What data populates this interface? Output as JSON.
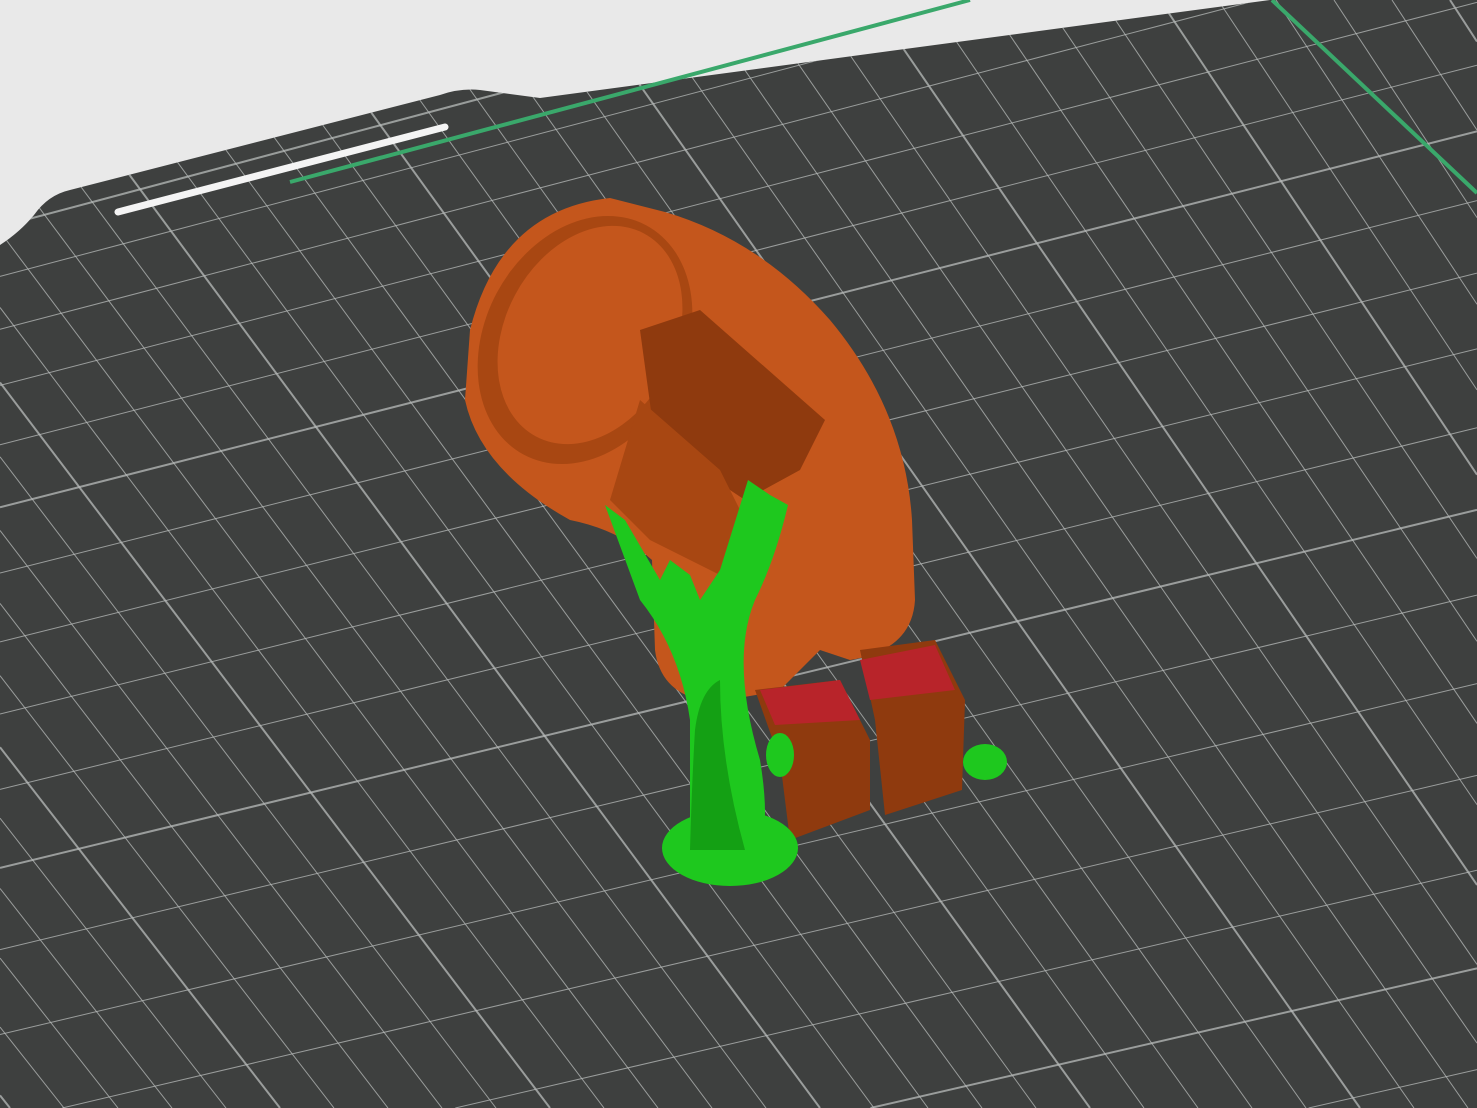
{
  "viewport": {
    "mode": "preview",
    "background_color": "#e9e9e9",
    "bed_color": "#3e403f",
    "grid_color": "#b9bcbb",
    "bed_edge_color": "#3aa86b",
    "slot_color": "#f4f4f4"
  },
  "model": {
    "part_color": "#c4561c",
    "part_shade_color": "#a84712",
    "part_dark_color": "#8f3a0e",
    "support_color": "#1ec81e",
    "support_shade_color": "#14a014",
    "interface_color": "#b8242a"
  }
}
